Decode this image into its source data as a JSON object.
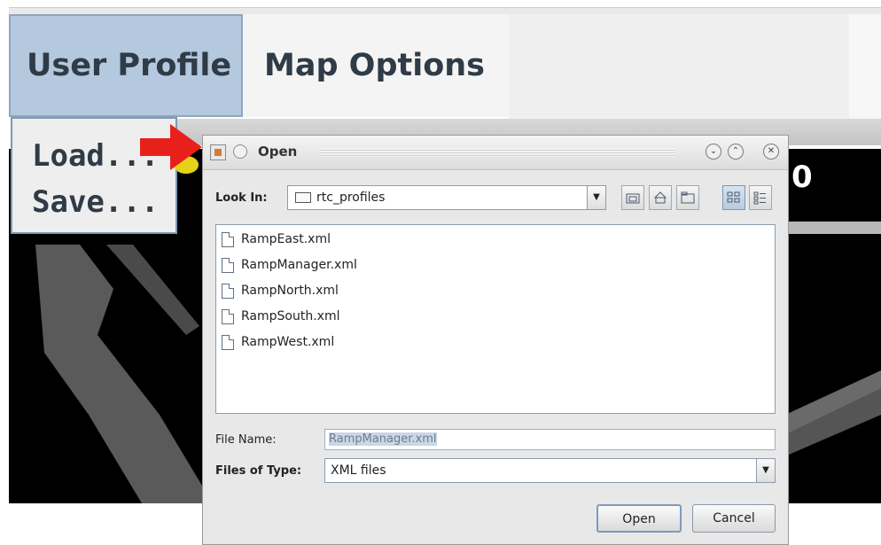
{
  "menubar": {
    "items": [
      {
        "label": "User Profile"
      },
      {
        "label": "Map Options"
      }
    ]
  },
  "user_profile_menu": {
    "items": [
      {
        "label": "Load..."
      },
      {
        "label": "Save..."
      }
    ]
  },
  "background": {
    "number_partial": "0"
  },
  "dialog": {
    "title": "Open",
    "look_in_label": "Look In:",
    "look_in_value": "rtc_profiles",
    "toolbar_icons": [
      "up-folder-icon",
      "home-icon",
      "new-folder-icon",
      "list-view-icon",
      "details-view-icon"
    ],
    "files": [
      {
        "name": "RampEast.xml"
      },
      {
        "name": "RampManager.xml"
      },
      {
        "name": "RampNorth.xml"
      },
      {
        "name": "RampSouth.xml"
      },
      {
        "name": "RampWest.xml"
      }
    ],
    "file_name_label": "File Name:",
    "file_name_value": "RampManager.xml",
    "files_of_type_label": "Files of Type:",
    "files_of_type_value": "XML files",
    "open_button": "Open",
    "cancel_button": "Cancel"
  },
  "colors": {
    "menu_selected": "#b4c8de",
    "arrow": "#e8201c",
    "dialog_bg": "#e8e8e8"
  }
}
